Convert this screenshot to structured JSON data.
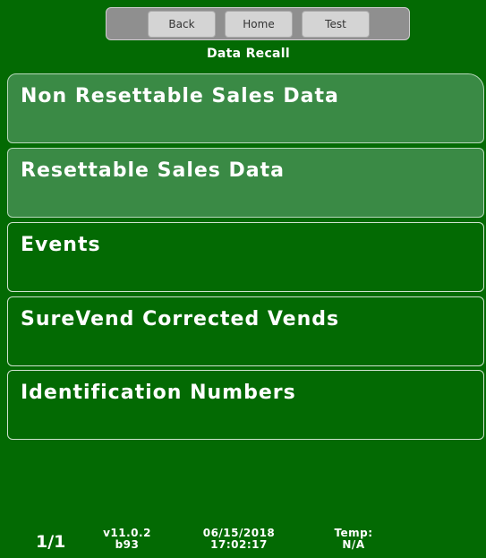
{
  "toolbar": {
    "back_label": "Back",
    "home_label": "Home",
    "test_label": "Test"
  },
  "screen": {
    "title": "Data Recall"
  },
  "menu": {
    "items": [
      {
        "label": "Non Resettable Sales Data",
        "highlighted": true
      },
      {
        "label": "Resettable Sales Data",
        "highlighted": true
      },
      {
        "label": "Events",
        "highlighted": false
      },
      {
        "label": "SureVend Corrected Vends",
        "highlighted": false
      },
      {
        "label": "Identification Numbers",
        "highlighted": false
      }
    ]
  },
  "status": {
    "page": "1/1",
    "version": "v11.0.2",
    "build": "b93",
    "date": "06/15/2018",
    "time": "17:02:17",
    "temp_label": "Temp:",
    "temp_value": "N/A"
  },
  "colors": {
    "background": "#036a03",
    "highlight": "#3a8a45",
    "toolbar": "#8f8f8f",
    "button": "#d4d4d4"
  }
}
